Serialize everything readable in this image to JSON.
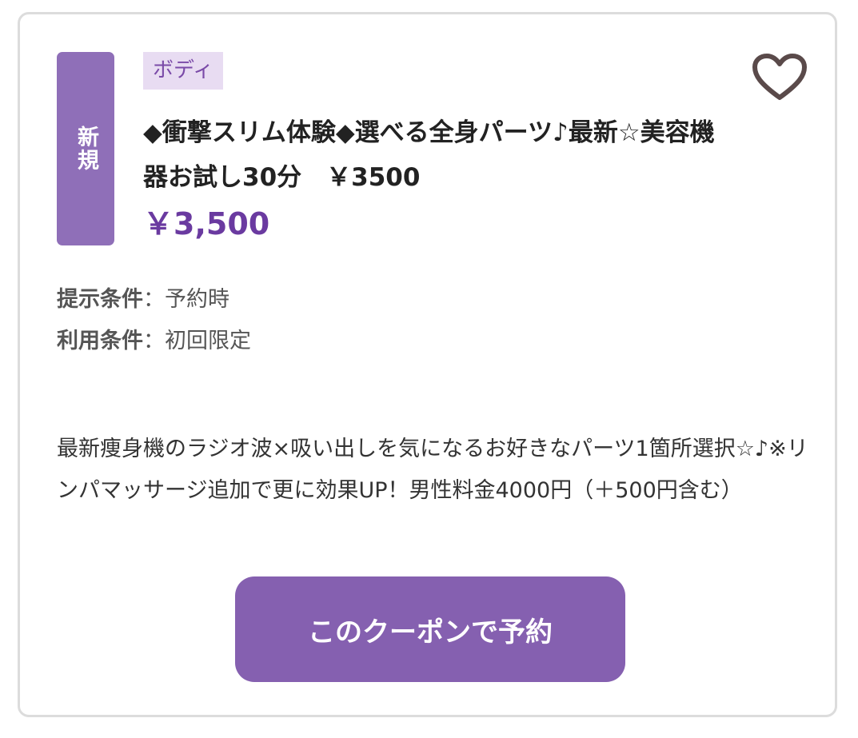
{
  "badge": {
    "label": "新規"
  },
  "category": {
    "label": "ボディ"
  },
  "favorite": {
    "icon": "heart-outline-icon"
  },
  "coupon": {
    "title": "◆衝撃スリム体験◆選べる全身パーツ♪最新☆美容機器お試し30分　￥3500",
    "price": "￥3,500",
    "conditions": [
      {
        "label": "提示条件",
        "separator": "：",
        "value": "予約時"
      },
      {
        "label": "利用条件",
        "separator": "：",
        "value": "初回限定"
      }
    ],
    "description": "最新痩身機のラジオ波×吸い出しを気になるお好きなパーツ1箇所選択☆♪※リンパマッサージ追加で更に効果UP！男性料金4000円（＋500円含む）"
  },
  "actions": {
    "book_label": "このクーポンで予約"
  },
  "colors": {
    "accent": "#8560b0",
    "badge": "#8f6fb8",
    "tag_bg": "#e8dcf2",
    "tag_text": "#7a4aa8",
    "price": "#6a3aa0",
    "heart": "#5a4a4a"
  }
}
